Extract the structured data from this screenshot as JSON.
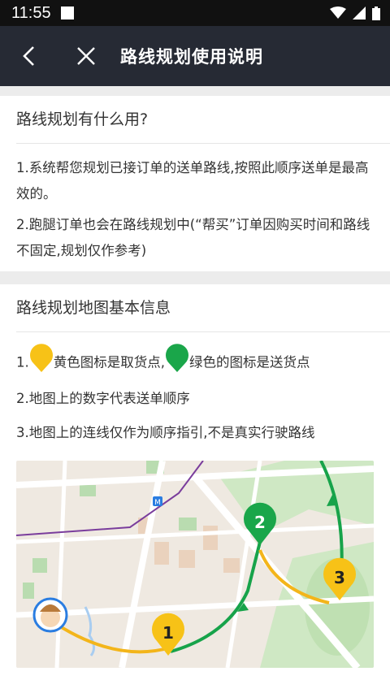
{
  "status_bar": {
    "time": "11:55"
  },
  "app_bar": {
    "title": "路线规划使用说明"
  },
  "section1": {
    "title": "路线规划有什么用?",
    "para1": "1.系统帮您规划已接订单的送单路线,按照此顺序送单是最高效的。",
    "para2": "2.跑腿订单也会在路线规划中(“帮买”订单因购买时间和路线不固定,规划仅作参考)"
  },
  "section2": {
    "title": "路线规划地图基本信息",
    "item1_prefix": "1.",
    "item1_yellow": "黄色图标是取货点,",
    "item1_green": "绿色的图标是送货点",
    "item2": "2.地图上的数字代表送单顺序",
    "item3": "3.地图上的连线仅作为顺序指引,不是真实行驶路线"
  },
  "map": {
    "markers": [
      "1",
      "2",
      "3"
    ],
    "metro_label": "M",
    "colors": {
      "pickup": "#f7c217",
      "dropoff": "#1aa64a",
      "route_yellow": "#f3b51a",
      "route_green": "#17a34a"
    }
  },
  "icons": [
    "back-icon",
    "close-icon",
    "wifi-icon",
    "cellular-signal-icon",
    "battery-icon"
  ]
}
